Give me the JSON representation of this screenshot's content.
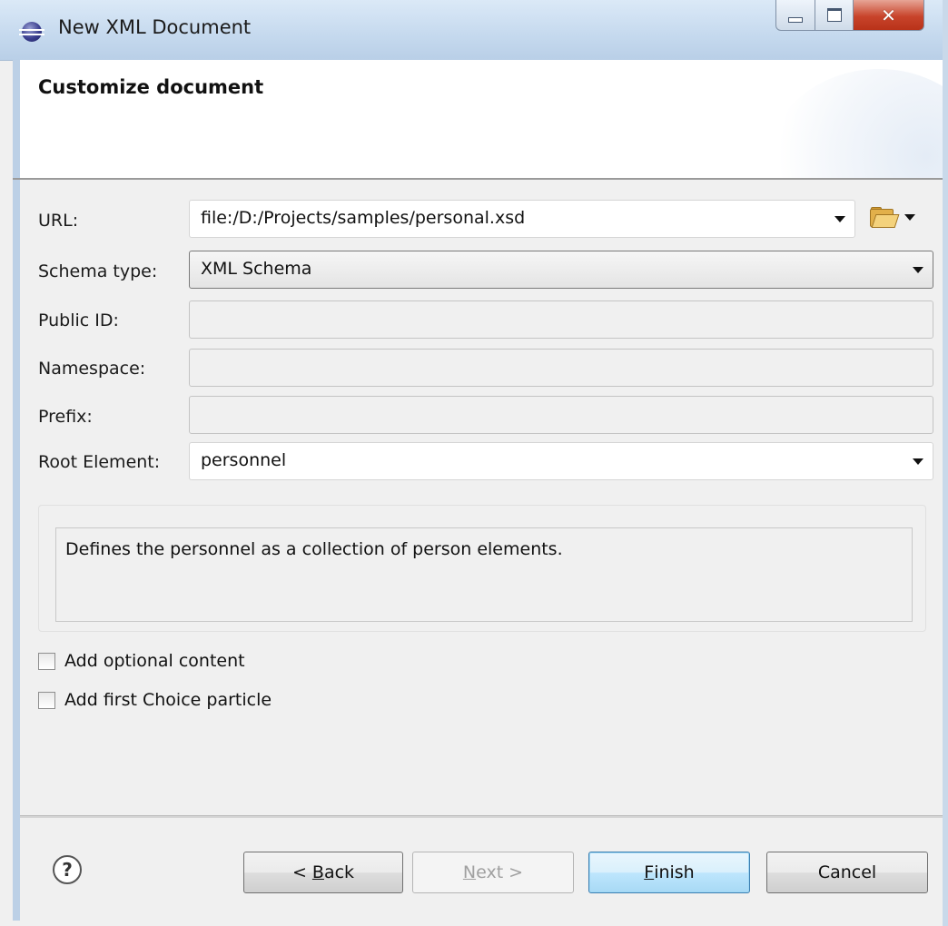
{
  "window": {
    "title": "New XML Document",
    "controls": [
      "minimize",
      "maximize",
      "close"
    ]
  },
  "banner": {
    "title": "Customize document"
  },
  "form": {
    "url": {
      "label": "URL:",
      "value": "file:/D:/Projects/samples/personal.xsd"
    },
    "schema_type": {
      "label": "Schema type:",
      "value": "XML Schema"
    },
    "public_id": {
      "label": "Public ID:",
      "value": ""
    },
    "namespace": {
      "label": "Namespace:",
      "value": ""
    },
    "prefix": {
      "label": "Prefix:",
      "value": ""
    },
    "root_element": {
      "label": "Root Element:",
      "value": "personnel"
    }
  },
  "description": "Defines the personnel as a collection of person elements.",
  "options": {
    "add_optional_content": {
      "label": "Add optional content",
      "checked": false
    },
    "add_first_choice": {
      "label": "Add first Choice particle",
      "checked": false
    }
  },
  "buttons": {
    "back": {
      "prefix": "< ",
      "mnemonic": "B",
      "rest": "ack"
    },
    "next": {
      "mnemonic": "N",
      "rest": "ext >"
    },
    "finish": {
      "mnemonic": "F",
      "rest": "inish"
    },
    "cancel": "Cancel"
  },
  "icons": {
    "app": "eclipse-icon",
    "folder": "folder-open-icon",
    "help": "help-icon"
  }
}
